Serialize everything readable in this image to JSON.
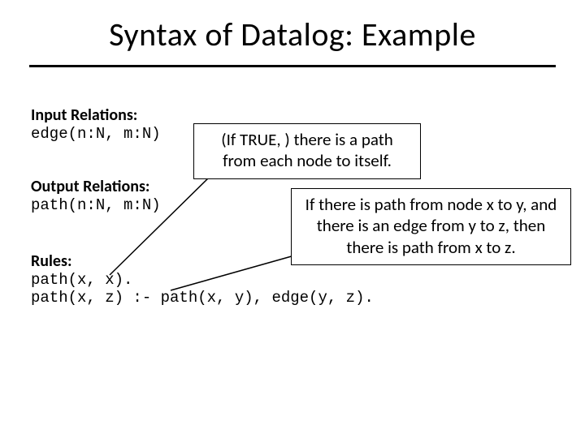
{
  "title": "Syntax of Datalog: Example",
  "sections": {
    "input": {
      "heading": "Input Relations:",
      "code": "edge(n:N, m:N)"
    },
    "output": {
      "heading": "Output Relations:",
      "code": "path(n:N, m:N)"
    },
    "rules": {
      "heading": "Rules:",
      "code": "path(x, x).\npath(x, z) :- path(x, y), edge(y, z)."
    }
  },
  "callouts": {
    "c1": "(If TRUE, ) there is a path from each node to itself.",
    "c2": "If there is path from node x to y, and there is an edge from y to z, then there is path from x to z."
  }
}
